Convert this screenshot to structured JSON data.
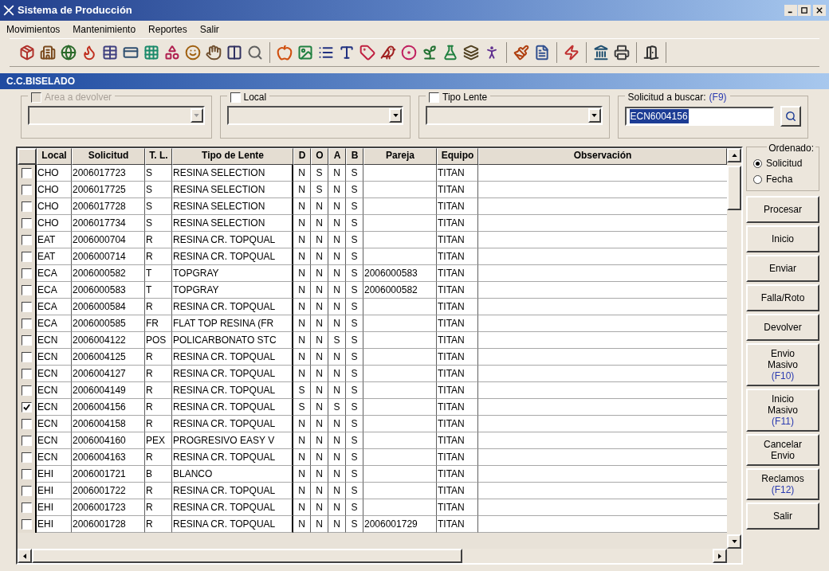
{
  "window": {
    "title": "Sistema de Producción"
  },
  "menu": [
    "Movimientos",
    "Mantenimiento",
    "Reportes",
    "Salir"
  ],
  "form_title": "C.C.BISELADO",
  "filters": [
    {
      "label": "Area a devolver",
      "checked": false,
      "disabled": true
    },
    {
      "label": "Local",
      "checked": false,
      "disabled": false
    },
    {
      "label": "Tipo Lente",
      "checked": false,
      "disabled": false
    }
  ],
  "search": {
    "label": "Solicitud a buscar:",
    "shortcut": "(F9)",
    "value": "ECN6004156"
  },
  "table": {
    "columns": [
      "Local",
      "Solicitud",
      "T. L.",
      "Tipo de Lente",
      "D",
      "O",
      "A",
      "B",
      "Pareja",
      "Equipo",
      "Observación"
    ],
    "rows": [
      {
        "checked": false,
        "cells": [
          "CHO",
          "2006017723",
          "S",
          "RESINA SELECTION",
          "N",
          "S",
          "N",
          "S",
          "",
          "TITAN"
        ]
      },
      {
        "checked": false,
        "cells": [
          "CHO",
          "2006017725",
          "S",
          "RESINA SELECTION",
          "N",
          "S",
          "N",
          "S",
          "",
          "TITAN"
        ]
      },
      {
        "checked": false,
        "cells": [
          "CHO",
          "2006017728",
          "S",
          "RESINA SELECTION",
          "N",
          "N",
          "N",
          "S",
          "",
          "TITAN"
        ]
      },
      {
        "checked": false,
        "cells": [
          "CHO",
          "2006017734",
          "S",
          "RESINA SELECTION",
          "N",
          "N",
          "N",
          "S",
          "",
          "TITAN"
        ]
      },
      {
        "checked": false,
        "cells": [
          "EAT",
          "2006000704",
          "R",
          "RESINA CR. TOPQUAL",
          "N",
          "N",
          "N",
          "S",
          "",
          "TITAN"
        ]
      },
      {
        "checked": false,
        "cells": [
          "EAT",
          "2006000714",
          "R",
          "RESINA CR. TOPQUAL",
          "N",
          "N",
          "N",
          "S",
          "",
          "TITAN"
        ]
      },
      {
        "checked": false,
        "cells": [
          "ECA",
          "2006000582",
          "T",
          "TOPGRAY",
          "N",
          "N",
          "N",
          "S",
          "2006000583",
          "TITAN"
        ]
      },
      {
        "checked": false,
        "cells": [
          "ECA",
          "2006000583",
          "T",
          "TOPGRAY",
          "N",
          "N",
          "N",
          "S",
          "2006000582",
          "TITAN"
        ]
      },
      {
        "checked": false,
        "cells": [
          "ECA",
          "2006000584",
          "R",
          "RESINA CR. TOPQUAL",
          "N",
          "N",
          "N",
          "S",
          "",
          "TITAN"
        ]
      },
      {
        "checked": false,
        "cells": [
          "ECA",
          "2006000585",
          "FR",
          "FLAT TOP RESINA (FR",
          "N",
          "N",
          "N",
          "S",
          "",
          "TITAN"
        ]
      },
      {
        "checked": false,
        "cells": [
          "ECN",
          "2006004122",
          "POS",
          "POLICARBONATO STC",
          "N",
          "N",
          "S",
          "S",
          "",
          "TITAN"
        ]
      },
      {
        "checked": false,
        "cells": [
          "ECN",
          "2006004125",
          "R",
          "RESINA CR. TOPQUAL",
          "N",
          "N",
          "N",
          "S",
          "",
          "TITAN"
        ]
      },
      {
        "checked": false,
        "cells": [
          "ECN",
          "2006004127",
          "R",
          "RESINA CR. TOPQUAL",
          "N",
          "N",
          "N",
          "S",
          "",
          "TITAN"
        ]
      },
      {
        "checked": false,
        "cells": [
          "ECN",
          "2006004149",
          "R",
          "RESINA CR. TOPQUAL",
          "S",
          "N",
          "N",
          "S",
          "",
          "TITAN"
        ]
      },
      {
        "checked": true,
        "cells": [
          "ECN",
          "2006004156",
          "R",
          "RESINA CR. TOPQUAL",
          "S",
          "N",
          "S",
          "S",
          "",
          "TITAN"
        ]
      },
      {
        "checked": false,
        "cells": [
          "ECN",
          "2006004158",
          "R",
          "RESINA CR. TOPQUAL",
          "N",
          "N",
          "N",
          "S",
          "",
          "TITAN"
        ]
      },
      {
        "checked": false,
        "cells": [
          "ECN",
          "2006004160",
          "PEX",
          "PROGRESIVO EASY V",
          "N",
          "N",
          "N",
          "S",
          "",
          "TITAN"
        ]
      },
      {
        "checked": false,
        "cells": [
          "ECN",
          "2006004163",
          "R",
          "RESINA CR. TOPQUAL",
          "N",
          "N",
          "N",
          "S",
          "",
          "TITAN"
        ]
      },
      {
        "checked": false,
        "cells": [
          "EHI",
          "2006001721",
          "B",
          "BLANCO",
          "N",
          "N",
          "N",
          "S",
          "",
          "TITAN"
        ]
      },
      {
        "checked": false,
        "cells": [
          "EHI",
          "2006001722",
          "R",
          "RESINA CR. TOPQUAL",
          "N",
          "N",
          "N",
          "S",
          "",
          "TITAN"
        ]
      },
      {
        "checked": false,
        "cells": [
          "EHI",
          "2006001723",
          "R",
          "RESINA CR. TOPQUAL",
          "N",
          "N",
          "N",
          "S",
          "",
          "TITAN"
        ]
      },
      {
        "checked": false,
        "cells": [
          "EHI",
          "2006001728",
          "R",
          "RESINA CR. TOPQUAL",
          "N",
          "N",
          "N",
          "S",
          "2006001729",
          "TITAN"
        ]
      }
    ]
  },
  "sort": {
    "label": "Ordenado:",
    "options": [
      {
        "label": "Solicitud",
        "selected": true
      },
      {
        "label": "Fecha",
        "selected": false
      }
    ]
  },
  "buttons": [
    {
      "lines": [
        "Procesar"
      ]
    },
    {
      "lines": [
        "Inicio"
      ]
    },
    {
      "lines": [
        "Enviar"
      ]
    },
    {
      "lines": [
        "Falla/Roto"
      ]
    },
    {
      "lines": [
        "Devolver"
      ]
    },
    {
      "lines": [
        "Envio",
        "Masivo"
      ],
      "shortcut": "(F10)"
    },
    {
      "lines": [
        "Inicio",
        "Masivo"
      ],
      "shortcut": "(F11)"
    },
    {
      "lines": [
        "Cancelar",
        "Envio"
      ]
    },
    {
      "lines": [
        "Reclamos"
      ],
      "shortcut": "(F12)"
    },
    {
      "lines": [
        "Salir"
      ]
    }
  ]
}
